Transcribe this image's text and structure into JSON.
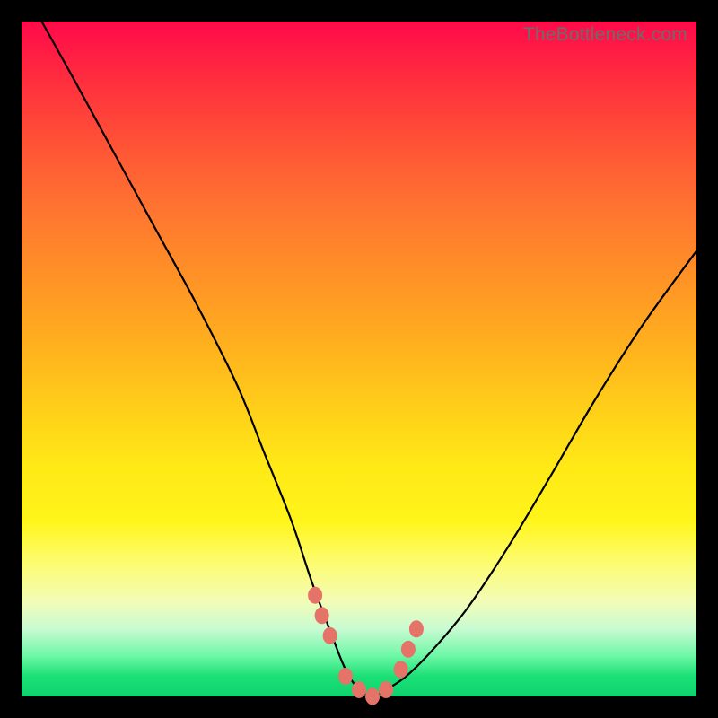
{
  "watermark": "TheBottleneck.com",
  "colors": {
    "background": "#000000",
    "gradient_top": "#ff0a4a",
    "gradient_bottom": "#0fd26f",
    "curve": "#000000",
    "marker": "#e57368"
  },
  "chart_data": {
    "type": "line",
    "title": "",
    "xlabel": "",
    "ylabel": "",
    "xlim": [
      0,
      100
    ],
    "ylim": [
      0,
      100
    ],
    "x": [
      3,
      8,
      14,
      20,
      26,
      32,
      36,
      40,
      43,
      46,
      48,
      50,
      52,
      54,
      57,
      61,
      66,
      72,
      78,
      85,
      92,
      100
    ],
    "values": [
      100,
      91,
      80,
      69,
      58,
      46,
      36,
      26,
      17,
      9,
      4,
      1,
      0,
      1,
      3,
      7,
      13,
      22,
      32,
      44,
      55,
      66
    ],
    "valley_markers_x": [
      43.5,
      44.5,
      45.7,
      48.0,
      50.0,
      52.0,
      54.0,
      56.2,
      57.3,
      58.5
    ],
    "valley_markers_y": [
      15,
      12,
      9,
      3,
      1,
      0,
      1,
      4,
      7,
      10
    ]
  }
}
